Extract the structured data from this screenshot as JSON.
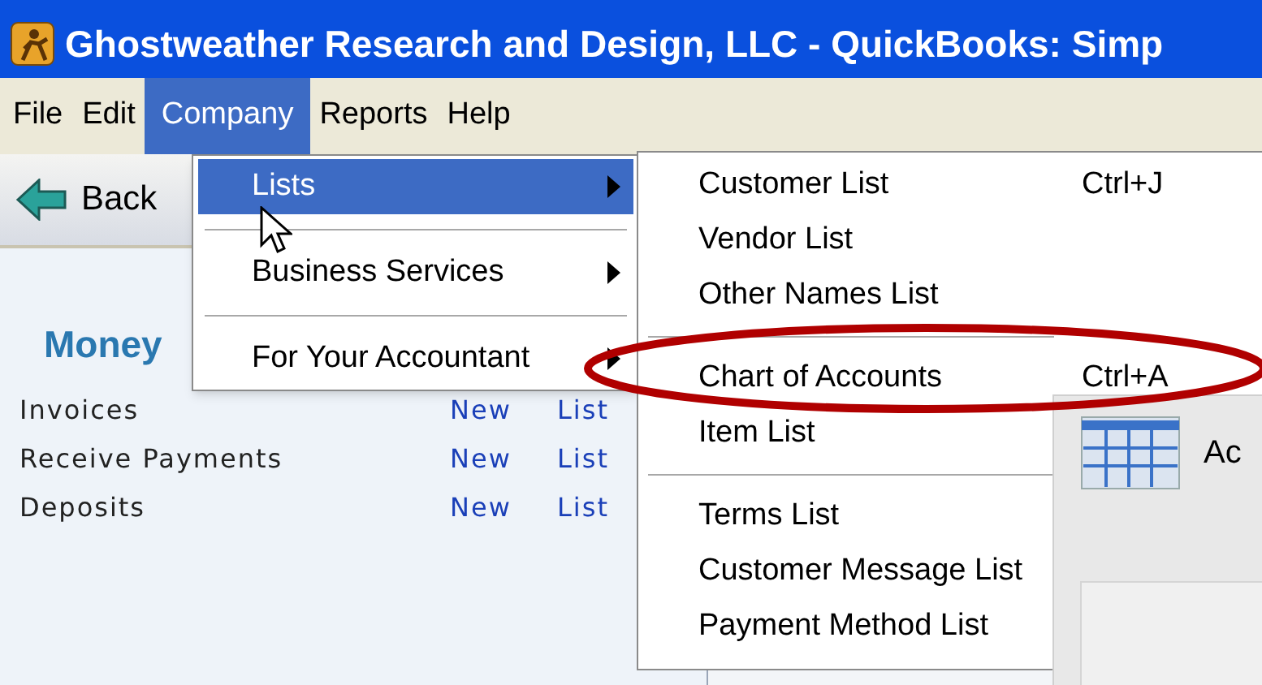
{
  "window": {
    "title": "Ghostweather Research and Design, LLC - QuickBooks: Simp"
  },
  "menu_bar": [
    {
      "label": "File",
      "selected": false
    },
    {
      "label": "Edit",
      "selected": false
    },
    {
      "label": "Company",
      "selected": true
    },
    {
      "label": "Reports",
      "selected": false
    },
    {
      "label": "Help",
      "selected": false
    }
  ],
  "company_menu": [
    {
      "kind": "item",
      "label": "Lists",
      "selected": true
    },
    {
      "kind": "separator"
    },
    {
      "kind": "item",
      "label": "Business Services",
      "selected": false
    },
    {
      "kind": "separator"
    },
    {
      "kind": "item",
      "label": "For Your Accountant",
      "selected": false
    }
  ],
  "lists_submenu": [
    {
      "kind": "item",
      "label": "Customer List",
      "shortcut": "Ctrl+J"
    },
    {
      "kind": "item",
      "label": "Vendor List"
    },
    {
      "kind": "item",
      "label": "Other Names List"
    },
    {
      "kind": "separator"
    },
    {
      "kind": "item",
      "label": "Chart of Accounts",
      "shortcut": "Ctrl+A"
    },
    {
      "kind": "item",
      "label": "Item List"
    },
    {
      "kind": "separator"
    },
    {
      "kind": "item",
      "label": "Terms List"
    },
    {
      "kind": "item",
      "label": "Customer Message List"
    },
    {
      "kind": "item",
      "label": "Payment Method List"
    }
  ],
  "navigation": {
    "back_button": "Back"
  },
  "sidebar": {
    "section_title": "Money",
    "rows": [
      {
        "label": "Invoices",
        "new": "New",
        "list": "List"
      },
      {
        "label": "Receive Payments",
        "new": "New",
        "list": "List"
      },
      {
        "label": "Deposits",
        "new": "New",
        "list": "List"
      }
    ]
  },
  "overlay_window": {
    "title": "Ac"
  }
}
